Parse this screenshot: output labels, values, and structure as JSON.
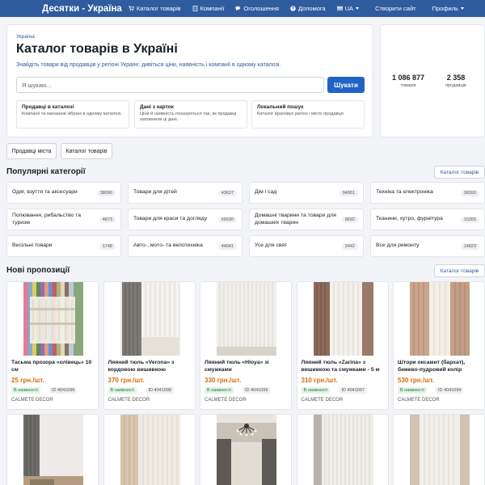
{
  "navbar": {
    "brand": "Десятки - Україна",
    "links": [
      {
        "label": "Каталог товарів",
        "icon": "cart-icon"
      },
      {
        "label": "Компанії",
        "icon": "building-icon"
      },
      {
        "label": "Оголошення",
        "icon": "chat-icon"
      },
      {
        "label": "Допомога",
        "icon": "question-icon"
      }
    ],
    "lang": "UA",
    "create_site": "Створити сайт",
    "profile": "Профиль"
  },
  "hero": {
    "breadcrumb": "Україна",
    "title": "Каталог товарів в Україні",
    "subtitle": "Знайдіть товари від продавців у регіоні Україні: дивіться ціни, наявність і компанії в одному каталозі.",
    "search_placeholder": "Я шукаю...",
    "search_button": "Шукати",
    "info": [
      {
        "title": "Продавці в каталозі",
        "text": "Компанії та магазини зібрані в одному каталозі."
      },
      {
        "title": "Дані з карток",
        "text": "Ціни й наявність показуються так, як продавці заповнили ці дані."
      },
      {
        "title": "Локальний пошук",
        "text": "Каталог враховує регіон і місто продавця."
      }
    ]
  },
  "stats": [
    {
      "value": "1 086 877",
      "label": "товарів"
    },
    {
      "value": "2 358",
      "label": "продавців"
    }
  ],
  "secondary_buttons": [
    "Продавці міста",
    "Каталог товарів"
  ],
  "categories_section": {
    "title": "Популярні категорії",
    "catalog_link": "Каталог товарів",
    "items": [
      {
        "name": "Одяг, взуття та аксесуари",
        "count": "38090"
      },
      {
        "name": "Товари для дітей",
        "count": "43637"
      },
      {
        "name": "Дім і сад",
        "count": "94951"
      },
      {
        "name": "Техніка та електроніка",
        "count": "36593"
      },
      {
        "name": "Полювання, рибальство та туризм",
        "count": "4873"
      },
      {
        "name": "Товари для краси та догляду",
        "count": "66630"
      },
      {
        "name": "Домашні тварини та товари для домашніх тварин",
        "count": "8692"
      },
      {
        "name": "Тканини, хутро, фурнітура",
        "count": "10265"
      },
      {
        "name": "Весільні товари",
        "count": "1748"
      },
      {
        "name": "Авто-, мото- та велотехніка",
        "count": "44041"
      },
      {
        "name": "Усе для свят",
        "count": "2442"
      },
      {
        "name": "Все для ремонту",
        "count": "14823"
      }
    ]
  },
  "products_section": {
    "title": "Нові пропозиції",
    "catalog_link": "Каталог товарів",
    "stock_label": "В наявності",
    "items": [
      {
        "title": "Тасьма прозора «олівець» 10 см",
        "price": "25 грн./шт.",
        "id": "ID 4041096",
        "seller": "CALMETE DECOR",
        "image": "fabric-swatches"
      },
      {
        "title": "Ляяний тюль «Verona» з кордовою вишивкою",
        "price": "370 грн./шт.",
        "id": "ID 4041098",
        "seller": "CALMETE DECOR",
        "image": "grey-curtain"
      },
      {
        "title": "Ляяний тюль «Hloya» зі смужками",
        "price": "330 грн./шт.",
        "id": "ID 4041099",
        "seller": "CALMETE DECOR",
        "image": "white-tulle"
      },
      {
        "title": "Ляяний тюль «Zarina» з вишивкою та смужками - 5 м",
        "price": "310 грн./шт.",
        "id": "ID 4041097",
        "seller": "CALMETE DECOR",
        "image": "brown-curtain"
      },
      {
        "title": "Штори оксамит (бархат), бежево-пудровий колір",
        "price": "530 грн./шт.",
        "id": "ID 4041094",
        "seller": "CALMETE DECOR",
        "image": "beige-curtain"
      }
    ],
    "more_images": [
      "grey-room-curtain",
      "white-beige-curtain",
      "chandelier-room",
      "striped-tulle",
      "white-lace-tulle"
    ]
  },
  "colors": {
    "navbar": "#2f5b9f",
    "primary_button": "#2163c4",
    "price": "#d86b0f",
    "stock": "#1e7a3a"
  }
}
